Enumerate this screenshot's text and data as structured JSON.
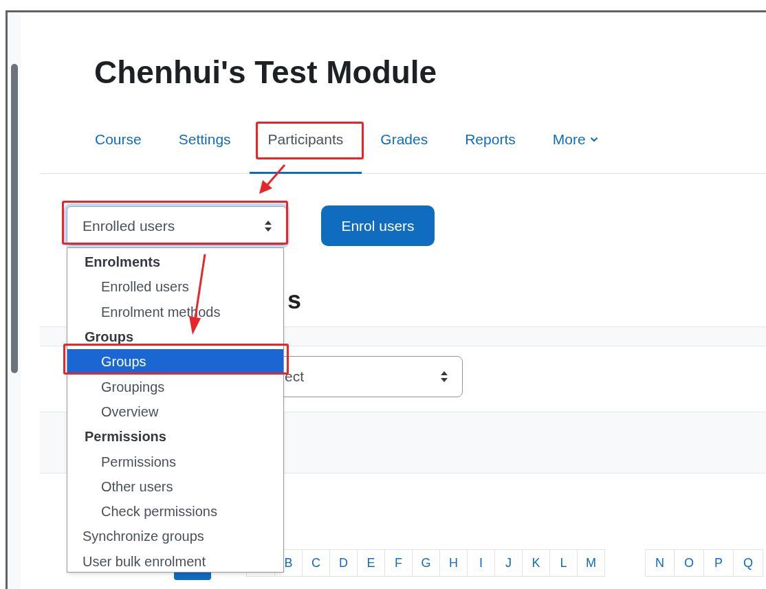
{
  "page_title": "Chenhui's Test Module",
  "tabs": [
    {
      "label": "Course",
      "selected": false
    },
    {
      "label": "Settings",
      "selected": false
    },
    {
      "label": "Participants",
      "selected": true
    },
    {
      "label": "Grades",
      "selected": false
    },
    {
      "label": "Reports",
      "selected": false
    },
    {
      "label": "More",
      "selected": false,
      "kind": "menu"
    }
  ],
  "page_select": {
    "value": "Enrolled users",
    "expanded": true
  },
  "enrol_button": "Enrol users",
  "menu": [
    {
      "kind": "group",
      "label": "Enrolments",
      "children": [
        {
          "label": "Enrolled users",
          "selected": false
        },
        {
          "label": "Enrolment methods",
          "selected": false
        }
      ]
    },
    {
      "kind": "group",
      "label": "Groups",
      "children": [
        {
          "label": "Groups",
          "selected": true
        },
        {
          "label": "Groupings",
          "selected": false
        },
        {
          "label": "Overview",
          "selected": false
        }
      ]
    },
    {
      "kind": "group",
      "label": "Permissions",
      "children": [
        {
          "label": "Permissions",
          "selected": false
        },
        {
          "label": "Other users",
          "selected": false
        },
        {
          "label": "Check permissions",
          "selected": false
        }
      ]
    },
    {
      "kind": "option",
      "label": "Synchronize groups",
      "selected": false
    },
    {
      "kind": "option",
      "label": "User bulk enrolment",
      "selected": false
    }
  ],
  "heading_partial": "s",
  "filter_select_partial": "ect",
  "letters_first": [
    "B",
    "C",
    "D",
    "E",
    "F",
    "G",
    "H",
    "I",
    "J",
    "K",
    "L",
    "M"
  ],
  "letters_second": [
    "N",
    "O",
    "P",
    "Q"
  ]
}
